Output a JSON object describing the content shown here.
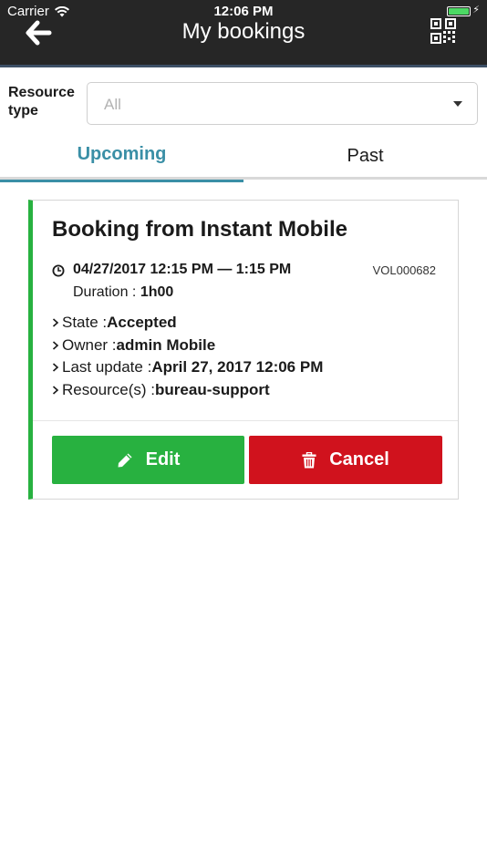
{
  "status_bar": {
    "carrier": "Carrier",
    "time": "12:06 PM",
    "battery_color": "#4cd964"
  },
  "header": {
    "title": "My bookings",
    "back_icon": "arrow-left-icon",
    "qr_icon": "qr-code-icon",
    "background": "#262626"
  },
  "filter": {
    "label": "Resource type",
    "selected": "All"
  },
  "tabs": [
    {
      "label": "Upcoming",
      "active": true
    },
    {
      "label": "Past",
      "active": false
    }
  ],
  "booking": {
    "title": "Booking from Instant Mobile",
    "date_range": "04/27/2017 12:15 PM — 1:15 PM",
    "reference": "VOL000682",
    "duration_label": "Duration : ",
    "duration_value": "1h00",
    "details": [
      {
        "label": "State : ",
        "value": "Accepted"
      },
      {
        "label": "Owner : ",
        "value": "admin Mobile"
      },
      {
        "label": "Last update : ",
        "value": "April 27, 2017 12:06 PM"
      },
      {
        "label": "Resource(s) : ",
        "value": "bureau-support"
      }
    ],
    "status_color": "#28b140",
    "edit_label": "Edit",
    "cancel_label": "Cancel"
  },
  "colors": {
    "accent": "#3a8fa6",
    "edit": "#28b140",
    "cancel": "#d0121d"
  }
}
